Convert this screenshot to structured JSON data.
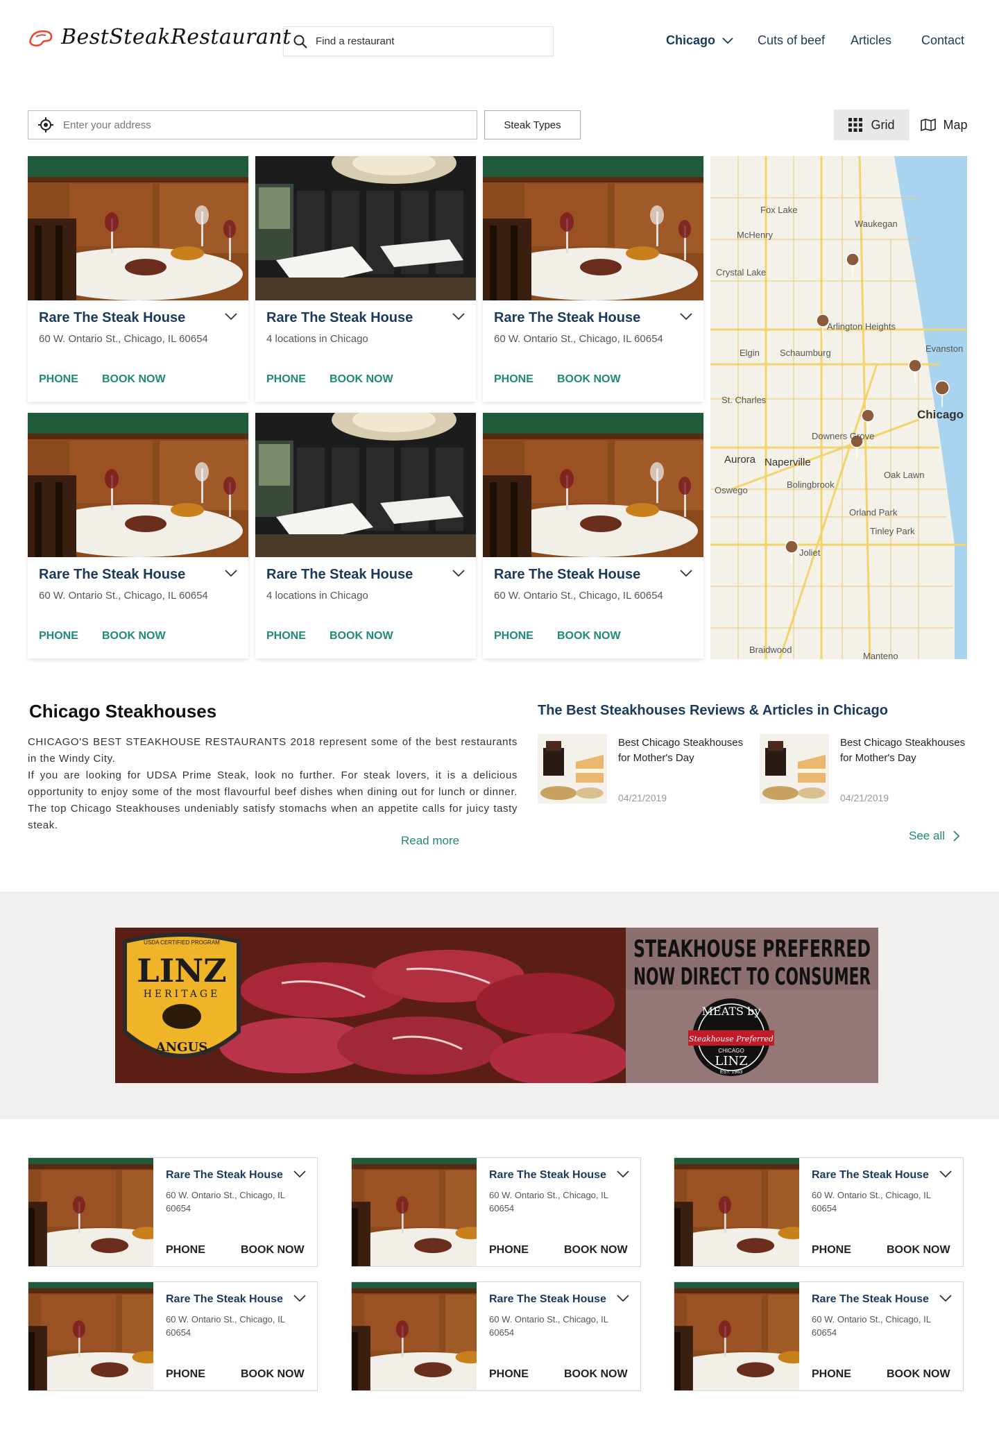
{
  "header": {
    "logo_text": "BestSteakRestaurant",
    "search_placeholder": "Find a restaurant",
    "nav": {
      "city": "Chicago",
      "cuts": "Cuts of beef",
      "articles": "Articles",
      "contact": "Contact"
    }
  },
  "filters": {
    "address_placeholder": "Enter your address",
    "steak_types": "Steak Types",
    "view_grid": "Grid",
    "view_map": "Map"
  },
  "cards": [
    {
      "title": "Rare The Steak House",
      "address": "60 W. Ontario St., Chicago, IL 60654",
      "phone": "PHONE",
      "book": "BOOK NOW",
      "photo": "dining-table"
    },
    {
      "title": "Rare The Steak House",
      "address": "4 locations in Chicago",
      "phone": "PHONE",
      "book": "BOOK NOW",
      "photo": "dark-room"
    },
    {
      "title": "Rare The Steak House",
      "address": "60 W. Ontario St., Chicago, IL 60654",
      "phone": "PHONE",
      "book": "BOOK NOW",
      "photo": "dining-table"
    },
    {
      "title": "Rare The Steak House",
      "address": "60 W. Ontario St., Chicago, IL 60654",
      "phone": "PHONE",
      "book": "BOOK NOW",
      "photo": "dining-table"
    },
    {
      "title": "Rare The Steak House",
      "address": "4 locations in Chicago",
      "phone": "PHONE",
      "book": "BOOK NOW",
      "photo": "dark-room"
    },
    {
      "title": "Rare The Steak House",
      "address": "60 W. Ontario St., Chicago, IL 60654",
      "phone": "PHONE",
      "book": "BOOK NOW",
      "photo": "dining-table"
    }
  ],
  "map": {
    "labels": [
      "Fox Lake",
      "Waukegan",
      "McHenry",
      "Crystal Lake",
      "Arlington Heights",
      "Evanston",
      "Elgin",
      "Schaumburg",
      "St. Charles",
      "Chicago",
      "Downers Grove",
      "Aurora",
      "Naperville",
      "Oak Lawn",
      "Oswego",
      "Bolingbrook",
      "Orland Park",
      "Tinley Park",
      "Joliet",
      "Braidwood",
      "Manteno"
    ]
  },
  "about": {
    "title": "Chicago Steakhouses",
    "p1": "CHICAGO'S BEST STEAKHOUSE RESTAURANTS 2018 represent some of the best restaurants in the Windy City.",
    "p2": "If you are looking for UDSA Prime Steak, look no further. For steak lovers, it is a delicious opportunity to enjoy some of the most flavourful beef dishes when dining out for lunch or dinner. The top Chicago Steakhouses undeniably satisfy stomachs when an appetite calls for juicy tasty steak.",
    "read_more": "Read more"
  },
  "reviews": {
    "title": "The Best Steakhouses Reviews & Articles in Chicago",
    "items": [
      {
        "title": "Best Chicago Steakhouses for Mother's Day",
        "date": "04/21/2019"
      },
      {
        "title": "Best Chicago Steakhouses for Mother's Day",
        "date": "04/21/2019"
      }
    ],
    "see_all": "See all"
  },
  "banner": {
    "left_badge_top": "USDA CERTIFIED PROGRAM",
    "left_brand": "LINZ",
    "left_sub": "HERITAGE",
    "left_bottom": "ANGUS",
    "right_headline_1": "STEAKHOUSE PREFERRED",
    "right_headline_2": "NOW DIRECT TO CONSUMER",
    "right_seal_top": "MEATS by",
    "right_seal_mid": "Steakhouse Preferred",
    "right_seal_city": "CHICAGO",
    "right_seal_bottom": "LINZ",
    "right_seal_est": "EST. 1963"
  },
  "small_cards": [
    {
      "title": "Rare The Steak House",
      "address": "60 W. Ontario St., Chicago, IL 60654",
      "phone": "PHONE",
      "book": "BOOK NOW"
    },
    {
      "title": "Rare The Steak House",
      "address": "60 W. Ontario St., Chicago, IL 60654",
      "phone": "PHONE",
      "book": "BOOK NOW"
    },
    {
      "title": "Rare The Steak House",
      "address": "60 W. Ontario St., Chicago, IL 60654",
      "phone": "PHONE",
      "book": "BOOK NOW"
    },
    {
      "title": "Rare The Steak House",
      "address": "60 W. Ontario St., Chicago, IL 60654",
      "phone": "PHONE",
      "book": "BOOK NOW"
    },
    {
      "title": "Rare The Steak House",
      "address": "60 W. Ontario St., Chicago, IL 60654",
      "phone": "PHONE",
      "book": "BOOK NOW"
    },
    {
      "title": "Rare The Steak House",
      "address": "60 W. Ontario St., Chicago, IL 60654",
      "phone": "PHONE",
      "book": "BOOK NOW"
    }
  ],
  "colors": {
    "accent": "#1f8a73",
    "heading": "#1a3a5c",
    "logo": "#e8452c"
  }
}
